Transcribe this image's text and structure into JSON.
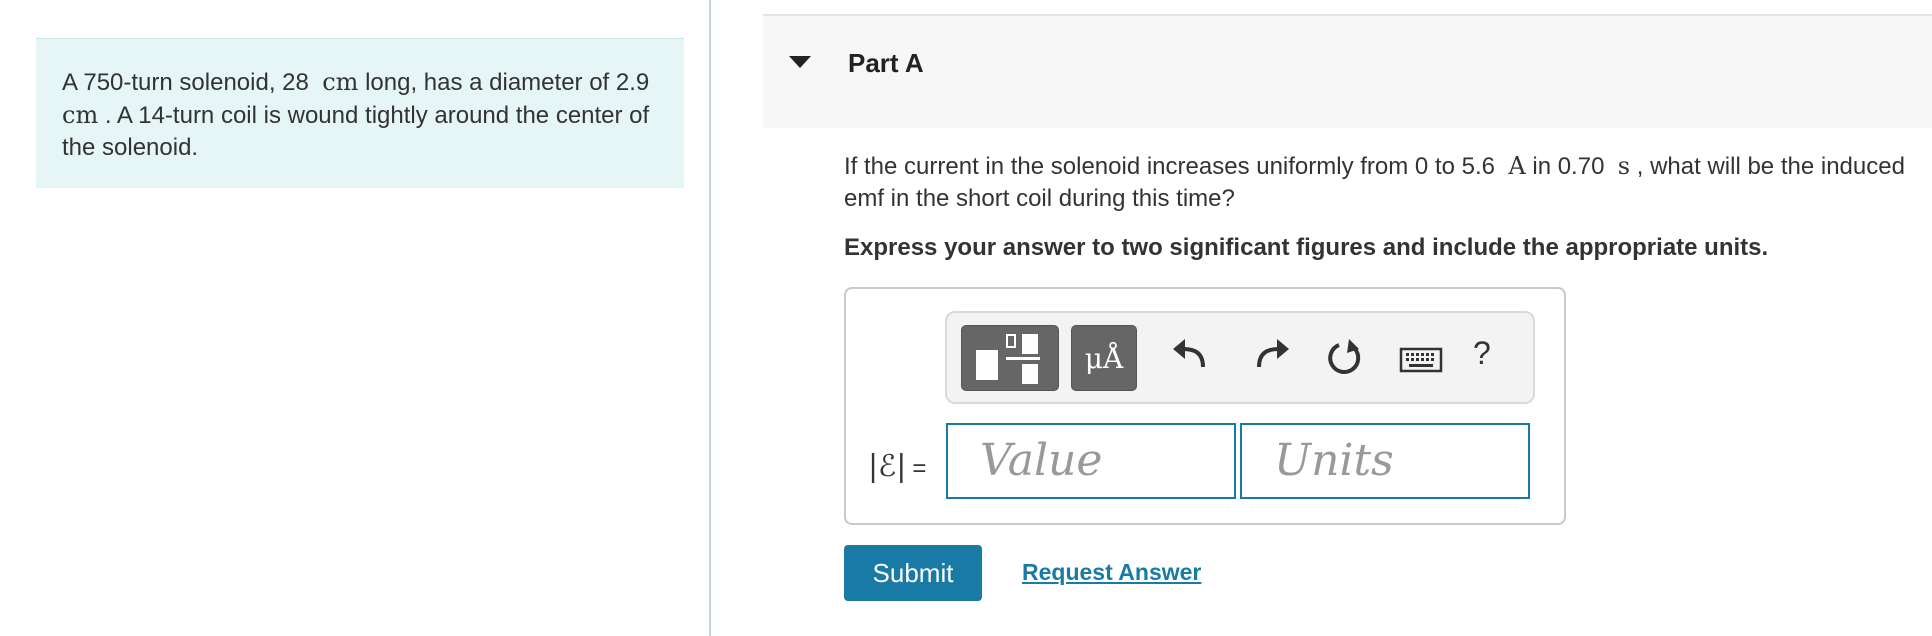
{
  "problem": {
    "part1": "A 750-turn solenoid, 28",
    "unit1": "cm",
    "part2": " long, has a diameter of 2.9",
    "unit2": "cm",
    "part3": ". A 14-turn coil is wound tightly around the center of the solenoid."
  },
  "part": {
    "title": "Part A",
    "expanded": true,
    "toggle_icon": "caret-down-icon"
  },
  "question": {
    "part1": "If the current in the solenoid increases uniformly from 0 to 5.6",
    "unit1": "A",
    "part2": " in 0.70",
    "unit2": "s",
    "part3": ", what will be the induced emf in the short coil during this time?"
  },
  "instruction": "Express your answer to two significant figures and include the appropriate units.",
  "toolbar": {
    "units_label": "μÅ",
    "help_label": "?",
    "icons": [
      "templates-icon",
      "units-icon",
      "undo-icon",
      "redo-icon",
      "reset-icon",
      "keyboard-icon",
      "help-icon"
    ]
  },
  "answer": {
    "label_symbol": "|ℰ|",
    "label_equals": "=",
    "value_placeholder": "Value",
    "units_placeholder": "Units"
  },
  "actions": {
    "submit_label": "Submit",
    "request_answer_label": "Request Answer"
  },
  "colors": {
    "accent": "#1a7aa6",
    "problem_bg": "#e6f5f5",
    "toolbar_dark": "#666666"
  }
}
